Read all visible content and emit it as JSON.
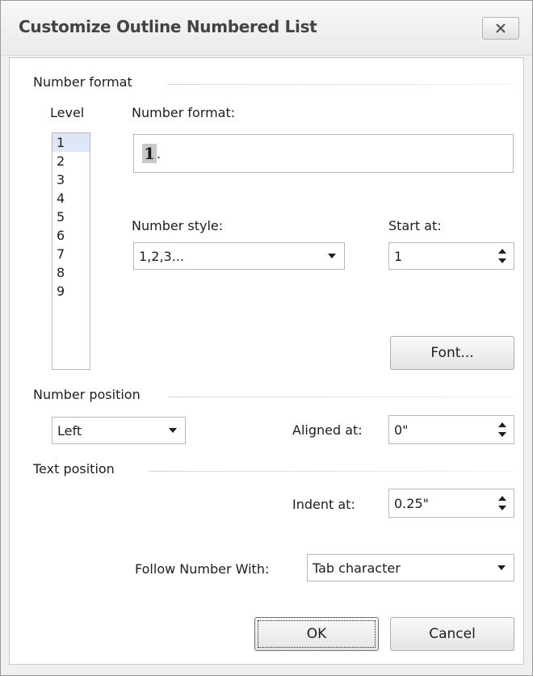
{
  "dialog": {
    "title": "Customize Outline Numbered List",
    "close_label": "x"
  },
  "number_format_group": {
    "title": "Number format",
    "level_label": "Level",
    "levels": [
      "1",
      "2",
      "3",
      "4",
      "5",
      "6",
      "7",
      "8",
      "9"
    ],
    "selected_level": "1",
    "format_label": "Number format:",
    "format_value_number": "1",
    "format_value_suffix": ".",
    "style_label": "Number style:",
    "style_value": "1,2,3...",
    "start_label": "Start at:",
    "start_value": "1",
    "font_button": "Font..."
  },
  "number_position_group": {
    "title": "Number position",
    "alignment_value": "Left",
    "aligned_at_label": "Aligned at:",
    "aligned_at_value": "0\""
  },
  "text_position_group": {
    "title": "Text position",
    "indent_at_label": "Indent at:",
    "indent_at_value": "0.25\"",
    "follow_label": "Follow Number With:",
    "follow_value": "Tab character"
  },
  "buttons": {
    "ok": "OK",
    "cancel": "Cancel"
  }
}
